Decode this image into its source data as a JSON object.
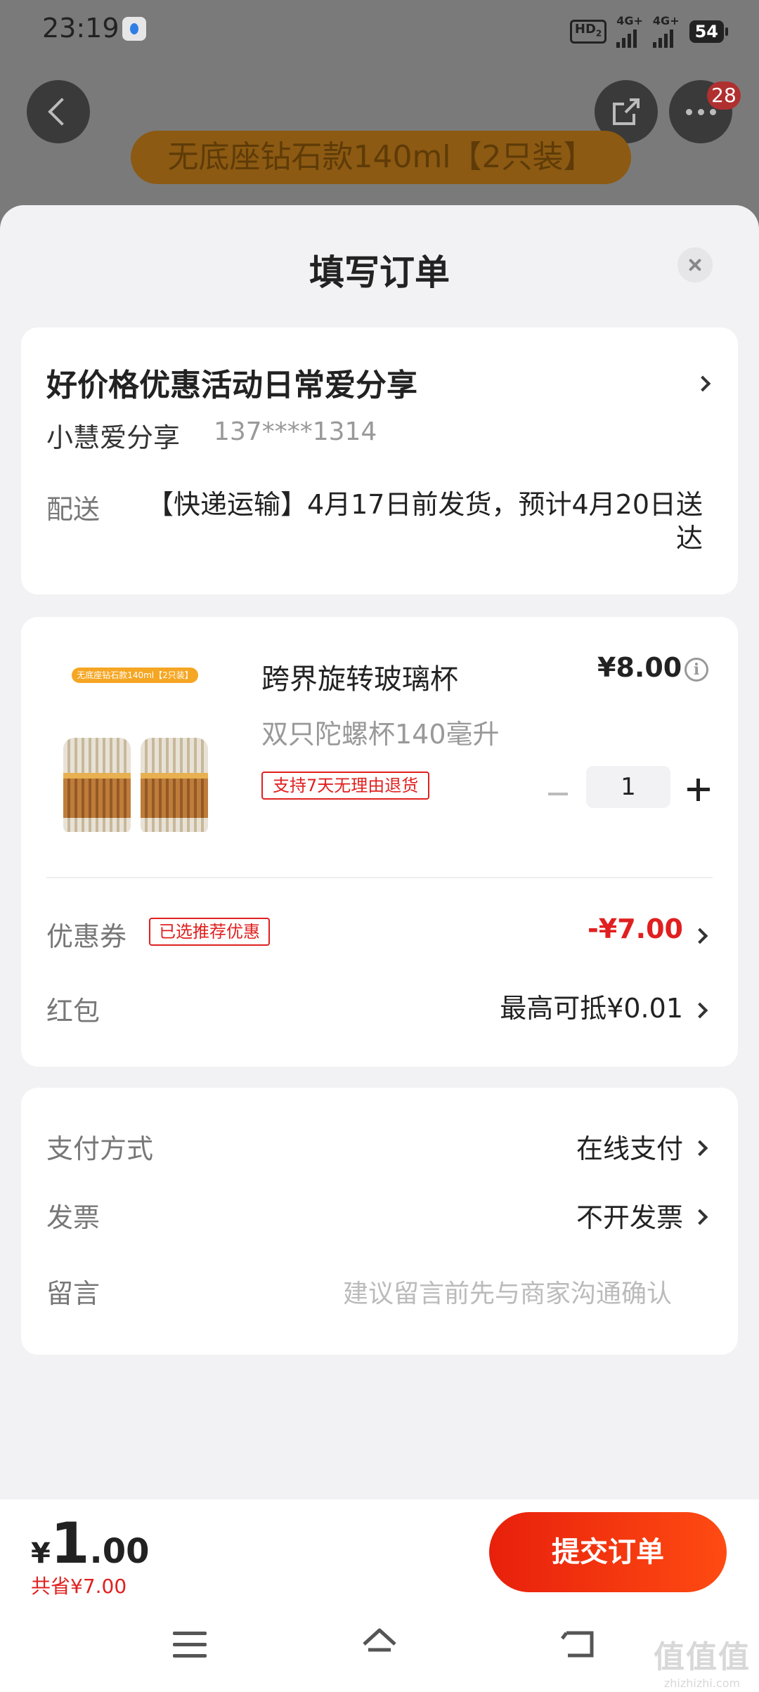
{
  "status_bar": {
    "time": "23:19",
    "hd": "HD",
    "hd_sub": "2",
    "net1": "4G+",
    "net2": "4G+",
    "battery": "54"
  },
  "background_page": {
    "banner_text": "无底座钻石款140ml【2只装】",
    "more_badge": "28"
  },
  "sheet": {
    "title": "填写订单"
  },
  "address": {
    "title": "好价格优惠活动日常爱分享",
    "name": "小慧爱分享",
    "phone": "137****1314",
    "delivery_label": "配送",
    "delivery_text": "【快递运输】4月17日前发货，预计4月20日送达"
  },
  "product": {
    "image_tag": "无底座钻石款140ml【2只装】",
    "name": "跨界旋转玻璃杯",
    "price": "¥8.00",
    "spec": "双只陀螺杯140毫升",
    "return_policy": "支持7天无理由退货",
    "quantity": "1"
  },
  "discounts": {
    "coupon_label": "优惠券",
    "coupon_tag": "已选推荐优惠",
    "coupon_value": "-¥7.00",
    "redpack_label": "红包",
    "redpack_value": "最高可抵¥0.01"
  },
  "payment": {
    "method_label": "支付方式",
    "method_value": "在线支付",
    "invoice_label": "发票",
    "invoice_value": "不开发票",
    "message_label": "留言",
    "message_placeholder": "建议留言前先与商家沟通确认"
  },
  "bottom": {
    "currency": "¥",
    "total_int": "1",
    "total_dec": ".00",
    "saved": "共省¥7.00",
    "submit_label": "提交订单"
  },
  "watermark": {
    "big": "值值值",
    "small": "zhizhizhi.com"
  },
  "colors": {
    "accent_red": "#e02020",
    "submit_gradient_start": "#e8200c",
    "submit_gradient_end": "#ff4b12",
    "background": "#f2f2f4"
  },
  "icons": [
    "back-icon",
    "share-icon",
    "more-icon",
    "close-icon",
    "info-icon",
    "minus-icon",
    "plus-icon",
    "chevron-right-icon",
    "menu-icon",
    "home-icon",
    "back-nav-icon"
  ]
}
